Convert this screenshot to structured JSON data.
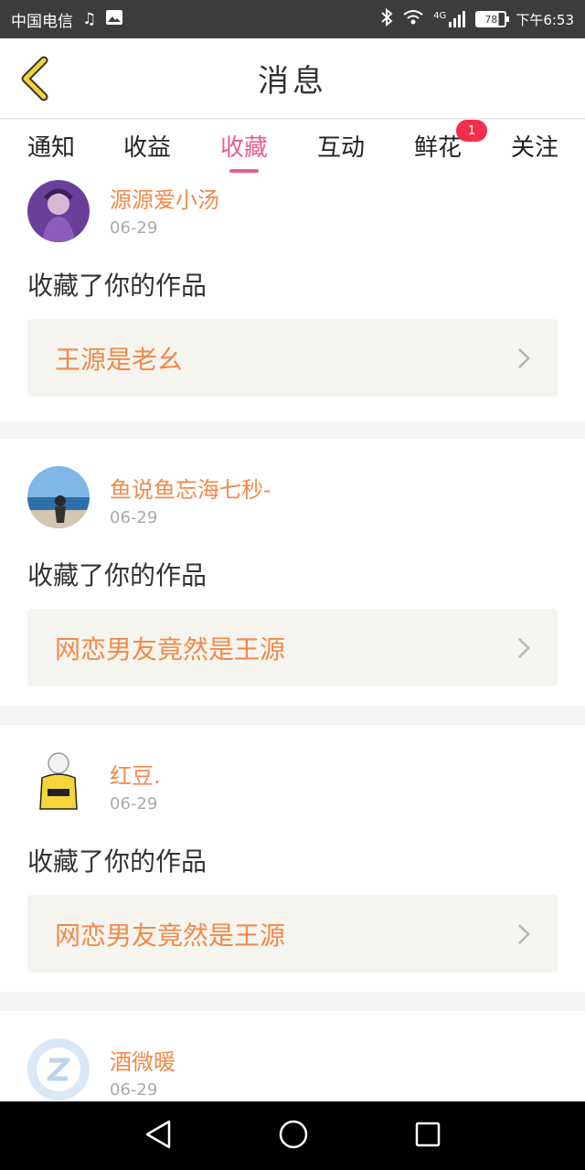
{
  "status_bar": {
    "carrier": "中国电信",
    "network": "4G",
    "battery": "78",
    "time": "下午6:53"
  },
  "header": {
    "title": "消息"
  },
  "tabs": [
    {
      "label": "通知"
    },
    {
      "label": "收益"
    },
    {
      "label": "收藏",
      "active": true
    },
    {
      "label": "互动"
    },
    {
      "label": "鲜花",
      "badge": "1"
    },
    {
      "label": "关注"
    }
  ],
  "feed": [
    {
      "username": "源源爱小汤",
      "date": "06-29",
      "action": "收藏了你的作品",
      "work_title": "王源是老幺"
    },
    {
      "username": "鱼说鱼忘海七秒-",
      "date": "06-29",
      "action": "收藏了你的作品",
      "work_title": "网恋男友竟然是王源"
    },
    {
      "username": "红豆.",
      "date": "06-29",
      "action": "收藏了你的作品",
      "work_title": "网恋男友竟然是王源"
    },
    {
      "username": "酒微暖",
      "date": "06-29"
    }
  ],
  "colors": {
    "accent_pink": "#e85f8a",
    "orange_text": "#f08a4c",
    "badge_red": "#f0304a",
    "back_arrow_yellow": "#f5d23c"
  }
}
